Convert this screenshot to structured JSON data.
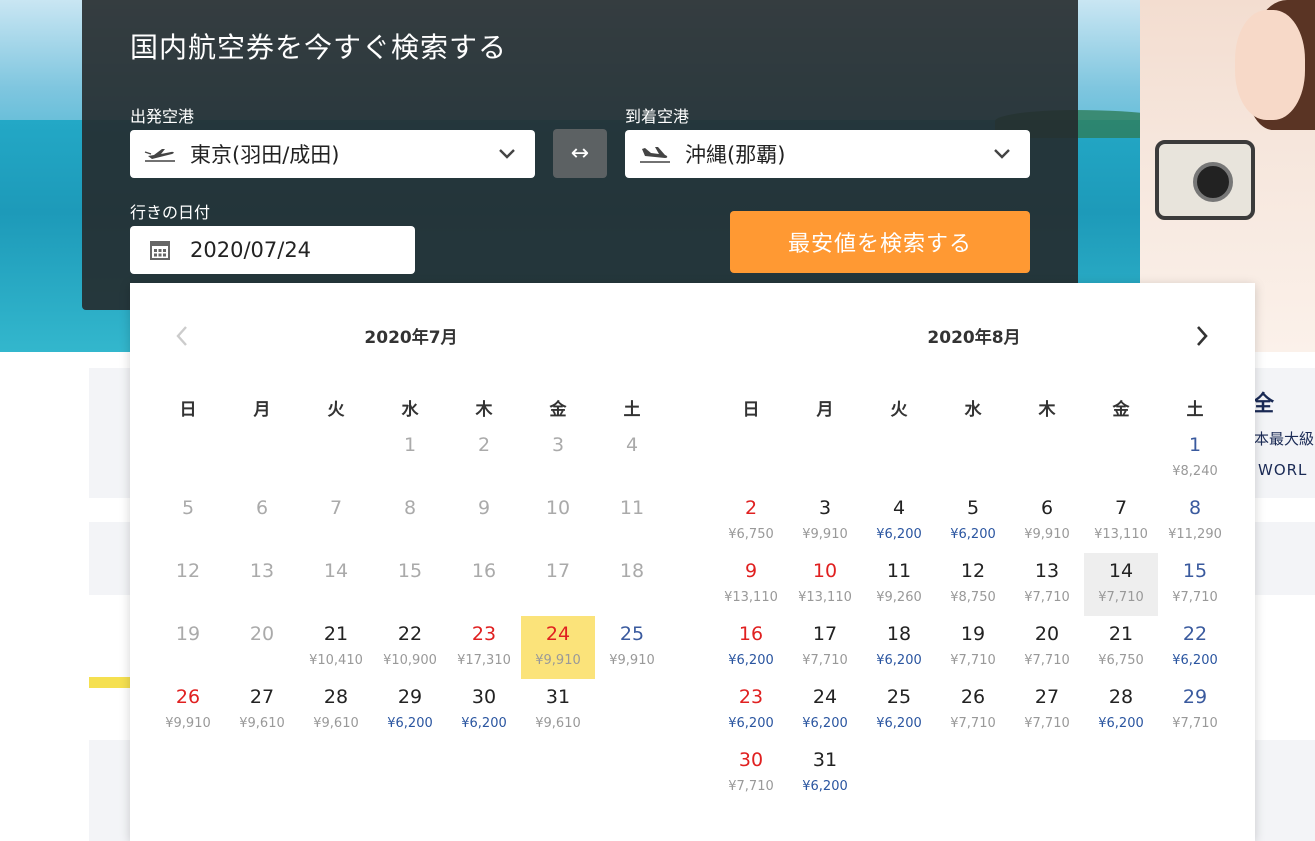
{
  "search": {
    "title": "国内航空券を今すぐ検索する",
    "departure_label": "出発空港",
    "departure_value": "東京(羽田/成田)",
    "arrival_label": "到着空港",
    "arrival_value": "沖縄(那覇)",
    "date_label": "行きの日付",
    "date_value": "2020/07/24",
    "swap_symbol": "↔",
    "search_button": "最安値を検索する"
  },
  "background": {
    "side_heading": "全",
    "side_line1": "本最大級",
    "side_line2": "WORL"
  },
  "calendar": {
    "weekdays": [
      "日",
      "月",
      "火",
      "水",
      "木",
      "金",
      "土"
    ],
    "months": [
      {
        "title": "2020年7月",
        "weeks": [
          [
            {
              "d": "",
              "p": ""
            },
            {
              "d": "",
              "p": ""
            },
            {
              "d": "",
              "p": ""
            },
            {
              "d": "1",
              "p": "",
              "past": true
            },
            {
              "d": "2",
              "p": "",
              "past": true
            },
            {
              "d": "3",
              "p": "",
              "past": true
            },
            {
              "d": "4",
              "p": "",
              "past": true
            }
          ],
          [
            {
              "d": "5",
              "p": "",
              "past": true
            },
            {
              "d": "6",
              "p": "",
              "past": true
            },
            {
              "d": "7",
              "p": "",
              "past": true
            },
            {
              "d": "8",
              "p": "",
              "past": true
            },
            {
              "d": "9",
              "p": "",
              "past": true
            },
            {
              "d": "10",
              "p": "",
              "past": true
            },
            {
              "d": "11",
              "p": "",
              "past": true
            }
          ],
          [
            {
              "d": "12",
              "p": "",
              "past": true
            },
            {
              "d": "13",
              "p": "",
              "past": true
            },
            {
              "d": "14",
              "p": "",
              "past": true
            },
            {
              "d": "15",
              "p": "",
              "past": true
            },
            {
              "d": "16",
              "p": "",
              "past": true
            },
            {
              "d": "17",
              "p": "",
              "past": true
            },
            {
              "d": "18",
              "p": "",
              "past": true
            }
          ],
          [
            {
              "d": "19",
              "p": "",
              "past": true
            },
            {
              "d": "20",
              "p": "",
              "past": true
            },
            {
              "d": "21",
              "p": "¥10,410"
            },
            {
              "d": "22",
              "p": "¥10,900"
            },
            {
              "d": "23",
              "p": "¥17,310",
              "holiday": true
            },
            {
              "d": "24",
              "p": "¥9,910",
              "holiday": true,
              "selected": true
            },
            {
              "d": "25",
              "p": "¥9,910"
            }
          ],
          [
            {
              "d": "26",
              "p": "¥9,910"
            },
            {
              "d": "27",
              "p": "¥9,610"
            },
            {
              "d": "28",
              "p": "¥9,610"
            },
            {
              "d": "29",
              "p": "¥6,200",
              "cheap": true
            },
            {
              "d": "30",
              "p": "¥6,200",
              "cheap": true
            },
            {
              "d": "31",
              "p": "¥9,610"
            },
            {
              "d": "",
              "p": ""
            }
          ]
        ]
      },
      {
        "title": "2020年8月",
        "weeks": [
          [
            {
              "d": "",
              "p": ""
            },
            {
              "d": "",
              "p": ""
            },
            {
              "d": "",
              "p": ""
            },
            {
              "d": "",
              "p": ""
            },
            {
              "d": "",
              "p": ""
            },
            {
              "d": "",
              "p": ""
            },
            {
              "d": "1",
              "p": "¥8,240"
            }
          ],
          [
            {
              "d": "2",
              "p": "¥6,750"
            },
            {
              "d": "3",
              "p": "¥9,910"
            },
            {
              "d": "4",
              "p": "¥6,200",
              "cheap": true
            },
            {
              "d": "5",
              "p": "¥6,200",
              "cheap": true
            },
            {
              "d": "6",
              "p": "¥9,910"
            },
            {
              "d": "7",
              "p": "¥13,110"
            },
            {
              "d": "8",
              "p": "¥11,290"
            }
          ],
          [
            {
              "d": "9",
              "p": "¥13,110"
            },
            {
              "d": "10",
              "p": "¥13,110",
              "holiday": true
            },
            {
              "d": "11",
              "p": "¥9,260"
            },
            {
              "d": "12",
              "p": "¥8,750"
            },
            {
              "d": "13",
              "p": "¥7,710"
            },
            {
              "d": "14",
              "p": "¥7,710",
              "hover": true
            },
            {
              "d": "15",
              "p": "¥7,710"
            }
          ],
          [
            {
              "d": "16",
              "p": "¥6,200",
              "cheap": true
            },
            {
              "d": "17",
              "p": "¥7,710"
            },
            {
              "d": "18",
              "p": "¥6,200",
              "cheap": true
            },
            {
              "d": "19",
              "p": "¥7,710"
            },
            {
              "d": "20",
              "p": "¥7,710"
            },
            {
              "d": "21",
              "p": "¥6,750"
            },
            {
              "d": "22",
              "p": "¥6,200",
              "cheap": true
            }
          ],
          [
            {
              "d": "23",
              "p": "¥6,200",
              "cheap": true
            },
            {
              "d": "24",
              "p": "¥6,200",
              "cheap": true
            },
            {
              "d": "25",
              "p": "¥6,200",
              "cheap": true
            },
            {
              "d": "26",
              "p": "¥7,710"
            },
            {
              "d": "27",
              "p": "¥7,710"
            },
            {
              "d": "28",
              "p": "¥6,200",
              "cheap": true
            },
            {
              "d": "29",
              "p": "¥7,710"
            }
          ],
          [
            {
              "d": "30",
              "p": "¥7,710"
            },
            {
              "d": "31",
              "p": "¥6,200",
              "cheap": true
            },
            {
              "d": "",
              "p": ""
            },
            {
              "d": "",
              "p": ""
            },
            {
              "d": "",
              "p": ""
            },
            {
              "d": "",
              "p": ""
            },
            {
              "d": "",
              "p": ""
            }
          ]
        ]
      }
    ]
  },
  "colors": {
    "accent": "#ff9933",
    "holiday": "#e02020",
    "saturday": "#3a5a9e",
    "cheap_price": "#2a55a0",
    "selected_bg": "#fbe37a"
  }
}
